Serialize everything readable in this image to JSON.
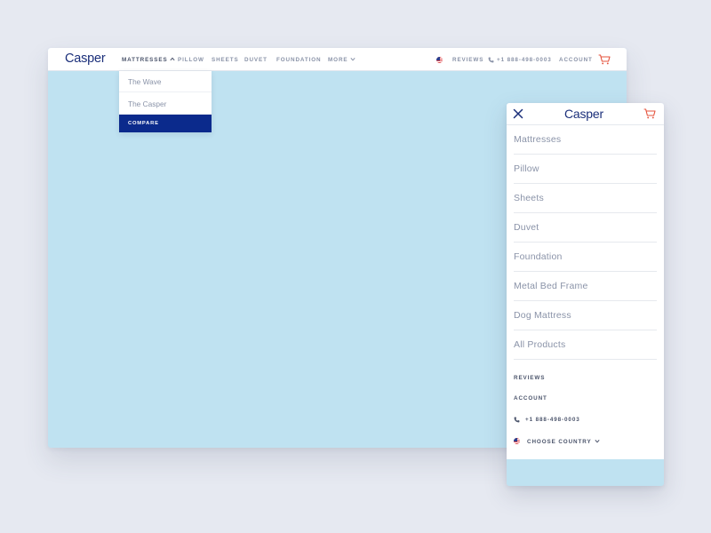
{
  "desktop": {
    "logo": "Casper",
    "nav": {
      "mattresses": "MATTRESSES",
      "pillow": "PILLOW",
      "sheets": "SHEETS",
      "duvet": "DUVET",
      "foundation": "FOUNDATION",
      "more": "MORE",
      "reviews": "REVIEWS",
      "phone": "+1 888-498-0003",
      "account": "ACCOUNT"
    },
    "dropdown": {
      "items": [
        "The Wave",
        "The Casper"
      ],
      "compare": "COMPARE"
    },
    "icons": {
      "flag": "us-flag-icon",
      "phone": "phone-icon",
      "cart": "cart-icon",
      "chevron_up": "chevron-up-icon",
      "chevron_down": "chevron-down-icon"
    }
  },
  "mobile": {
    "logo": "Casper",
    "items": [
      "Mattresses",
      "Pillow",
      "Sheets",
      "Duvet",
      "Foundation",
      "Metal Bed Frame",
      "Dog Mattress",
      "All Products"
    ],
    "reviews": "REVIEWS",
    "account": "ACCOUNT",
    "phone": "+1 888-498-0003",
    "choose_country": "CHOOSE COUNTRY",
    "icons": {
      "close": "close-icon",
      "cart": "cart-icon"
    }
  },
  "colors": {
    "brand": "#1b2f7a",
    "compare_bg": "#0b2a8c",
    "cart": "#e5533d",
    "hero_bg": "#bfe2f1",
    "page_bg": "#e6e9f1"
  }
}
